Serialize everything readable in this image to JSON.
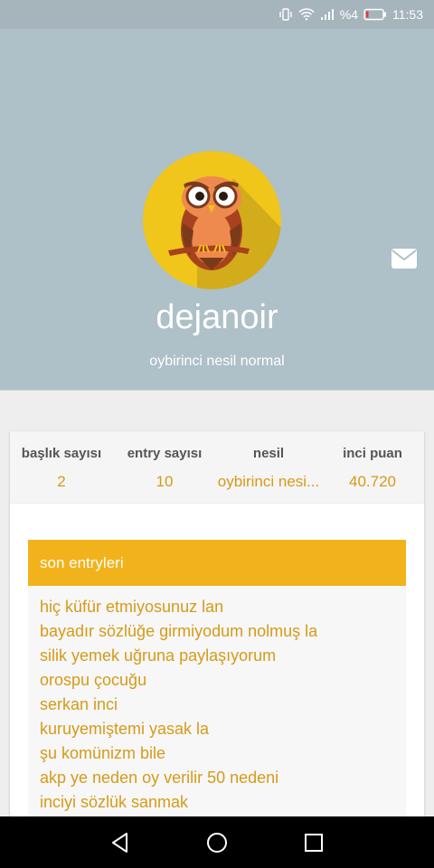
{
  "status_bar": {
    "battery_percent": "%4",
    "time": "11:53",
    "icons": [
      "vibrate-icon",
      "wifi-icon",
      "signal-icon",
      "battery-icon"
    ]
  },
  "profile": {
    "username": "dejanoir",
    "subtitle": "oybirinci nesil normal",
    "avatar": "owl-avatar",
    "mail_icon": "mail-icon"
  },
  "stats": [
    {
      "label": "başlık sayısı",
      "value": "2"
    },
    {
      "label": "entry sayısı",
      "value": "10"
    },
    {
      "label": "nesil",
      "value": "oybirinci nesi..."
    },
    {
      "label": "inci puan",
      "value": "40.720"
    }
  ],
  "entries": {
    "title": "son entryleri",
    "items": [
      "hiç küfür etmiyosunuz lan",
      "bayadır sözlüğe girmiyodum nolmuş la",
      "silik yemek uğruna paylaşıyorum",
      "orospu çocuğu",
      "serkan inci",
      "kuruyemiştemi yasak la",
      "şu komünizm bile",
      "akp ye neden oy verilir 50 nedeni",
      "inciyi sözlük sanmak"
    ]
  },
  "nav": {
    "back": "back-icon",
    "home": "home-icon",
    "recents": "recents-icon"
  },
  "colors": {
    "header": "#aec0c8",
    "accent": "#f2b21b",
    "link": "#d69a19",
    "avatar_bg": "#f0c61a"
  }
}
